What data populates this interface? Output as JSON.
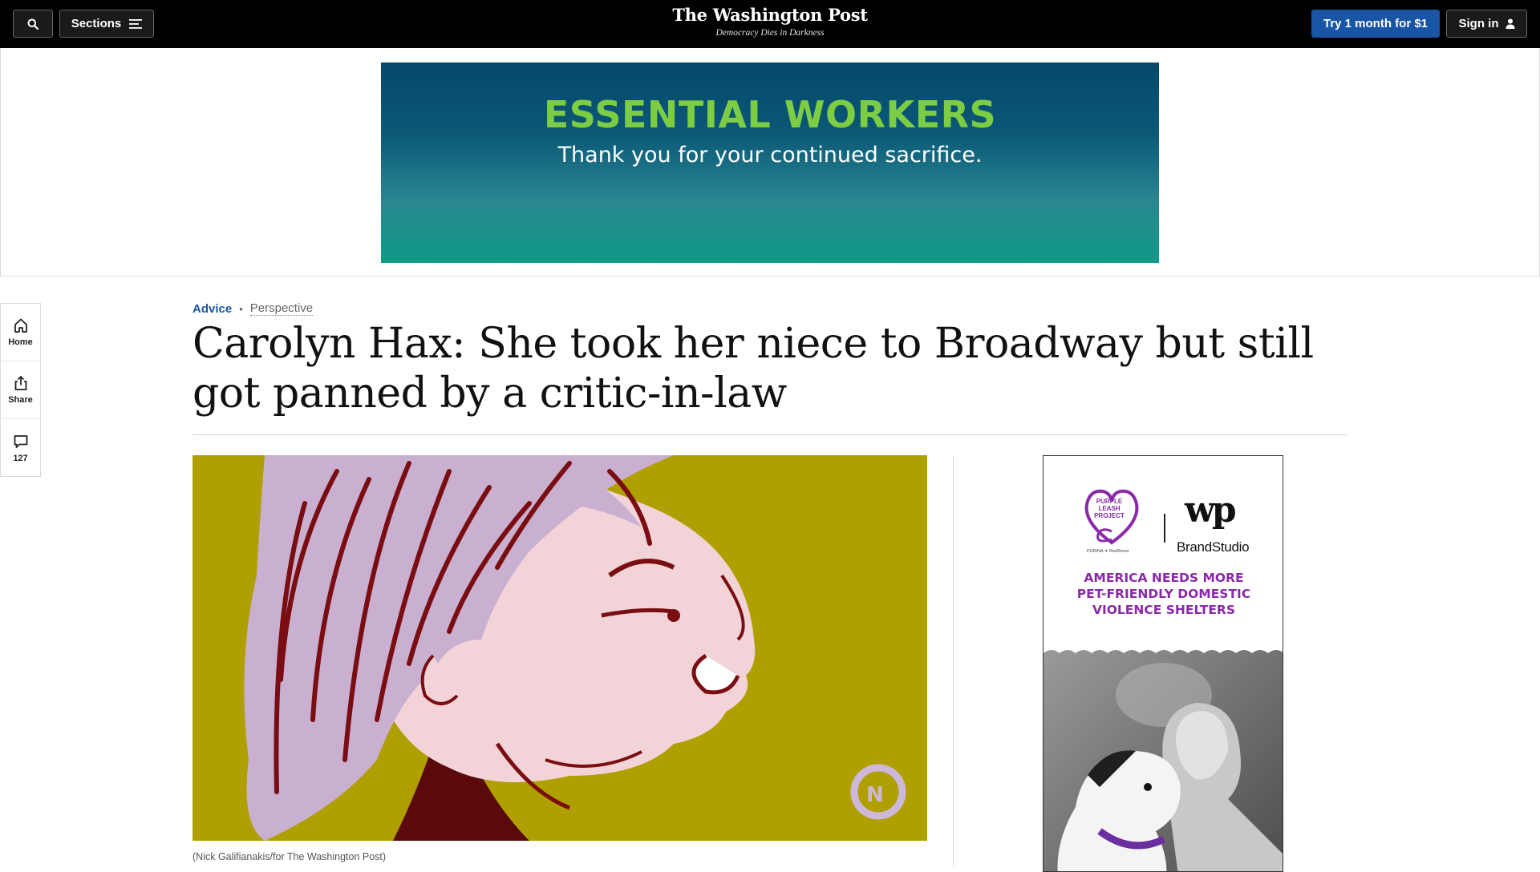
{
  "topnav": {
    "search_icon": "search-icon",
    "sections_label": "Sections",
    "sections_icon": "menu-icon",
    "masthead_title": "The Washington Post",
    "masthead_tagline": "Democracy Dies in Darkness",
    "trial_label": "Try 1 month for $1",
    "signin_label": "Sign in",
    "signin_icon": "user-icon",
    "trial_color": "#1955a5"
  },
  "banner_ad": {
    "headline": "ESSENTIAL WORKERS",
    "subline": "Thank you for your continued sacrifice.",
    "headline_color": "#7ccc44"
  },
  "share_rail": {
    "items": [
      {
        "icon": "home-icon",
        "label": "Home"
      },
      {
        "icon": "share-icon",
        "label": "Share"
      },
      {
        "icon": "comment-icon",
        "label": "127"
      }
    ]
  },
  "article": {
    "section": "Advice",
    "label": "Perspective",
    "headline": "Carolyn Hax: She took her niece to Broadway but still got panned by a critic-in-law",
    "image_caption": "(Nick Galifianakis/for The Washington Post)",
    "section_color": "#1955a5"
  },
  "side_ad": {
    "partner_name": "PURPLE LEASH",
    "partner_sub": "PROJECT",
    "partner_sponsors": "PURINA ✦ RedRover",
    "publisher_mark": "wp",
    "publisher_name": "BrandStudio",
    "headline_line1": "AMERICA NEEDS MORE",
    "headline_line2": "PET-FRIENDLY DOMESTIC",
    "headline_line3": "VIOLENCE SHELTERS",
    "headline_color": "#8a2aa8"
  }
}
